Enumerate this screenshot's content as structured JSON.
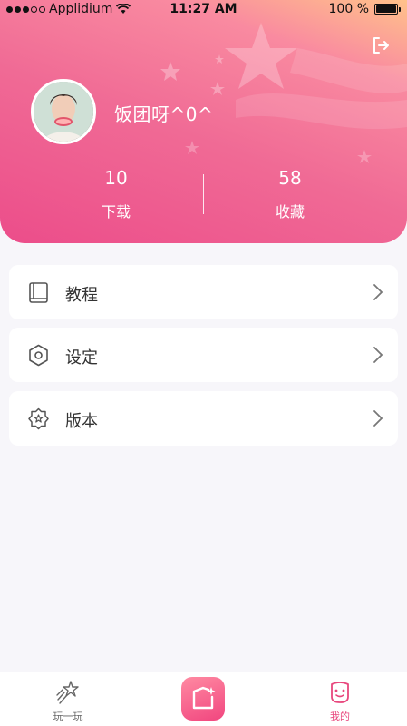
{
  "status_bar": {
    "carrier": "Applidium",
    "time": "11:27 AM",
    "battery": "100 %",
    "battery_level": 1.0
  },
  "header": {
    "username": "饭团呀^0^",
    "stats": [
      {
        "value": "10",
        "label": "下载"
      },
      {
        "value": "58",
        "label": "收藏"
      }
    ],
    "logout_icon": "logout-icon"
  },
  "menu": [
    {
      "label": "教程",
      "icon": "book-icon"
    },
    {
      "label": "设定",
      "icon": "hexagon-settings-icon"
    },
    {
      "label": "版本",
      "icon": "badge-star-icon"
    }
  ],
  "tabbar": {
    "tabs": [
      {
        "label": "玩一玩",
        "icon": "shooting-star-icon",
        "active": false
      },
      {
        "label": "",
        "icon": "create-icon",
        "active": false
      },
      {
        "label": "我的",
        "icon": "smiley-face-icon",
        "active": true
      }
    ]
  },
  "colors": {
    "accent": "#f06a95",
    "active_tab": "#e8477d",
    "inactive_tab": "#666666"
  }
}
